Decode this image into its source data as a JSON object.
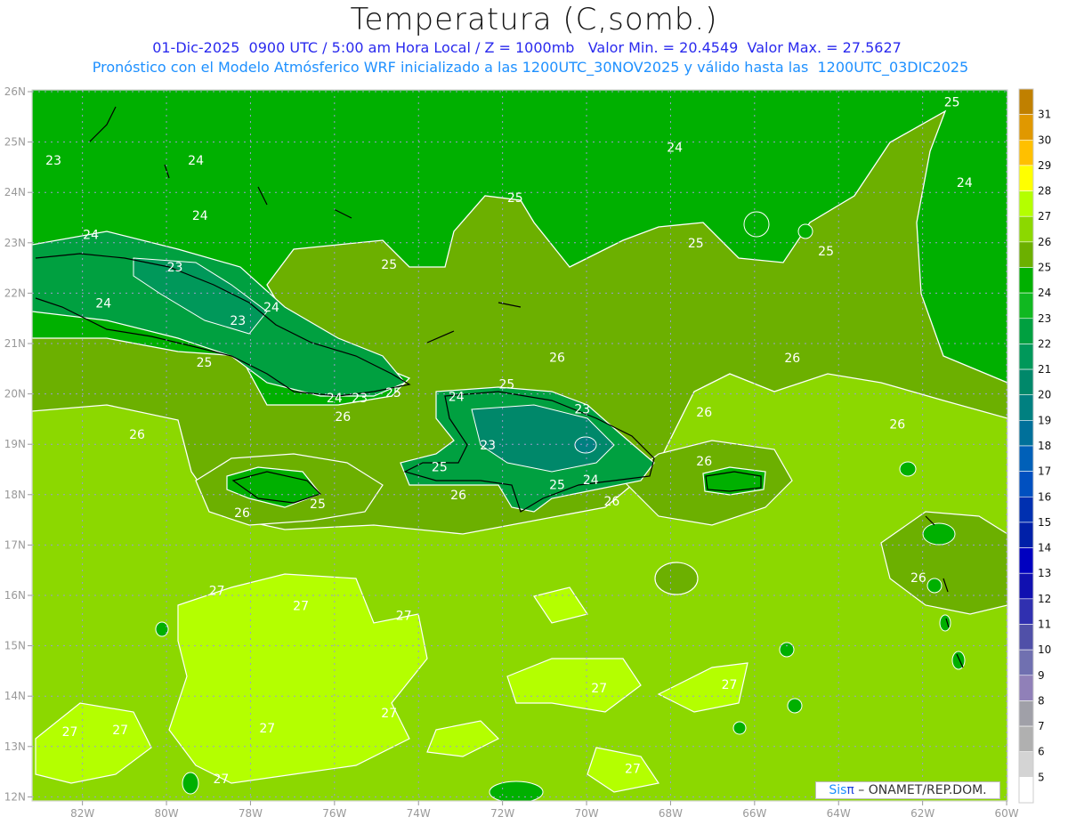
{
  "header": {
    "title": "Temperatura (C,somb.)",
    "line1": "01-Dic-2025  0900 UTC / 5:00 am Hora Local / Z = 1000mb   Valor Min. = 20.4549  Valor Max. = 27.5627",
    "line2": "Pronóstico con el Modelo Atmósferico WRF inicializado a las 1200UTC_30NOV2025 y válido hasta las  1200UTC_03DIC2025"
  },
  "axes": {
    "lon_labels": [
      "82W",
      "80W",
      "78W",
      "76W",
      "74W",
      "72W",
      "70W",
      "68W",
      "66W",
      "64W",
      "62W",
      "60W"
    ],
    "lon_values": [
      -82,
      -80,
      -78,
      -76,
      -74,
      -72,
      -70,
      -68,
      -66,
      -64,
      -62,
      -60
    ],
    "lat_labels": [
      "26N",
      "25N",
      "24N",
      "23N",
      "22N",
      "21N",
      "20N",
      "19N",
      "18N",
      "17N",
      "16N",
      "15N",
      "14N",
      "13N",
      "12N"
    ],
    "lat_values": [
      26,
      25,
      24,
      23,
      22,
      21,
      20,
      19,
      18,
      17,
      16,
      15,
      14,
      13,
      12
    ]
  },
  "colorbar": {
    "labels": [
      "31",
      "30",
      "29",
      "28",
      "27",
      "26",
      "25",
      "24",
      "23",
      "22",
      "21",
      "20",
      "19",
      "18",
      "17",
      "16",
      "15",
      "14",
      "13",
      "12",
      "11",
      "10",
      "9",
      "8",
      "7",
      "6",
      "5"
    ],
    "colors": [
      "#c08000",
      "#e09800",
      "#ffc000",
      "#ffff00",
      "#b4ff00",
      "#8cd800",
      "#6cb000",
      "#00b000",
      "#10b820",
      "#00a040",
      "#00985a",
      "#00886a",
      "#008080",
      "#00709a",
      "#0060b8",
      "#0050c0",
      "#0030b0",
      "#0020a8",
      "#0000c0",
      "#1010b0",
      "#3030b0",
      "#5050a8",
      "#7070b0",
      "#9080b8",
      "#a0a0a8",
      "#b0b0b0",
      "#d4d4d4",
      "#ffffff"
    ]
  },
  "contour_labels": [
    {
      "text": "23",
      "lon": -82.69,
      "lat": 24.64
    },
    {
      "text": "24",
      "lon": -79.3,
      "lat": 24.64
    },
    {
      "text": "24",
      "lon": -79.2,
      "lat": 23.54
    },
    {
      "text": "24",
      "lon": -81.8,
      "lat": 23.16
    },
    {
      "text": "23",
      "lon": -79.8,
      "lat": 22.52
    },
    {
      "text": "24",
      "lon": -81.5,
      "lat": 21.8
    },
    {
      "text": "23",
      "lon": -78.3,
      "lat": 21.46
    },
    {
      "text": "24",
      "lon": -77.5,
      "lat": 21.72
    },
    {
      "text": "25",
      "lon": -79.1,
      "lat": 20.63
    },
    {
      "text": "24",
      "lon": -76.0,
      "lat": 19.92
    },
    {
      "text": "23",
      "lon": -75.4,
      "lat": 19.92
    },
    {
      "text": "25",
      "lon": -74.6,
      "lat": 20.03
    },
    {
      "text": "26",
      "lon": -75.8,
      "lat": 19.55
    },
    {
      "text": "26",
      "lon": -80.7,
      "lat": 19.2
    },
    {
      "text": "25",
      "lon": -71.7,
      "lat": 23.9
    },
    {
      "text": "24",
      "lon": -67.9,
      "lat": 24.9
    },
    {
      "text": "25",
      "lon": -61.3,
      "lat": 25.8
    },
    {
      "text": "24",
      "lon": -61.0,
      "lat": 24.2
    },
    {
      "text": "25",
      "lon": -67.4,
      "lat": 23.0
    },
    {
      "text": "25",
      "lon": -64.3,
      "lat": 22.84
    },
    {
      "text": "25",
      "lon": -74.7,
      "lat": 22.57
    },
    {
      "text": "26",
      "lon": -70.7,
      "lat": 20.73
    },
    {
      "text": "25",
      "lon": -71.9,
      "lat": 20.2
    },
    {
      "text": "24",
      "lon": -73.1,
      "lat": 19.95
    },
    {
      "text": "23",
      "lon": -70.1,
      "lat": 19.7
    },
    {
      "text": "23",
      "lon": -72.35,
      "lat": 18.99
    },
    {
      "text": "25",
      "lon": -73.5,
      "lat": 18.55
    },
    {
      "text": "26",
      "lon": -73.05,
      "lat": 18.0
    },
    {
      "text": "25",
      "lon": -70.7,
      "lat": 18.2
    },
    {
      "text": "24",
      "lon": -69.9,
      "lat": 18.3
    },
    {
      "text": "26",
      "lon": -69.4,
      "lat": 17.87
    },
    {
      "text": "26",
      "lon": -67.2,
      "lat": 18.67
    },
    {
      "text": "26",
      "lon": -67.2,
      "lat": 19.64
    },
    {
      "text": "26",
      "lon": -65.1,
      "lat": 20.72
    },
    {
      "text": "26",
      "lon": -62.6,
      "lat": 19.4
    },
    {
      "text": "26",
      "lon": -62.1,
      "lat": 16.35
    },
    {
      "text": "25",
      "lon": -76.4,
      "lat": 17.82
    },
    {
      "text": "26",
      "lon": -78.2,
      "lat": 17.64
    },
    {
      "text": "27",
      "lon": -78.8,
      "lat": 16.1
    },
    {
      "text": "27",
      "lon": -76.8,
      "lat": 15.8
    },
    {
      "text": "27",
      "lon": -74.35,
      "lat": 15.6
    },
    {
      "text": "27",
      "lon": -74.7,
      "lat": 13.67
    },
    {
      "text": "27",
      "lon": -77.6,
      "lat": 13.37
    },
    {
      "text": "27",
      "lon": -82.3,
      "lat": 13.3
    },
    {
      "text": "27",
      "lon": -81.1,
      "lat": 13.33
    },
    {
      "text": "27",
      "lon": -78.7,
      "lat": 12.36
    },
    {
      "text": "27",
      "lon": -69.7,
      "lat": 14.16
    },
    {
      "text": "27",
      "lon": -66.6,
      "lat": 14.23
    },
    {
      "text": "27",
      "lon": -68.9,
      "lat": 12.56
    }
  ],
  "credit": {
    "brand_sis": "Sis",
    "brand_pi": "π",
    "rest": " – ONAMET/REP.DOM."
  }
}
